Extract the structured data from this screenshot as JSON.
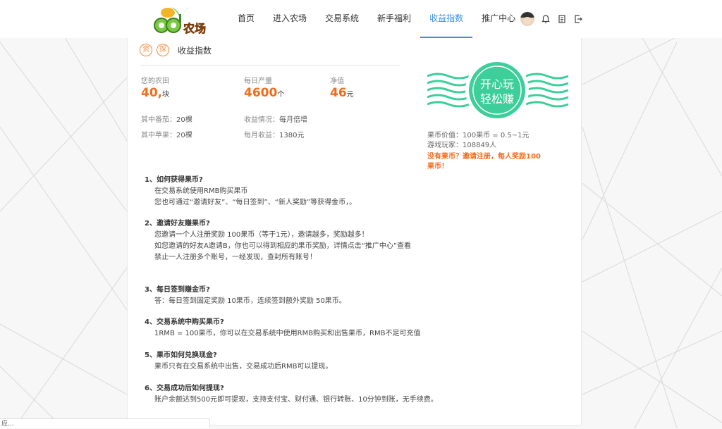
{
  "header": {
    "logo_text": "QQ农场",
    "nav": [
      {
        "label": "首页",
        "active": false
      },
      {
        "label": "进入农场",
        "active": false
      },
      {
        "label": "交易系统",
        "active": false
      },
      {
        "label": "新手福利",
        "active": false
      },
      {
        "label": "收益指数",
        "active": true
      },
      {
        "label": "推广中心",
        "active": false
      }
    ],
    "icons": [
      "avatar",
      "bell-icon",
      "document-icon",
      "exit-icon"
    ]
  },
  "panel": {
    "tags": [
      "资",
      "採"
    ],
    "title": "收益指数",
    "stats": {
      "farmland": {
        "label": "您的农田",
        "value": "40,",
        "unit": "块"
      },
      "daily": {
        "label": "每日产量",
        "value": "4600",
        "unit": "个"
      },
      "net": {
        "label": "净值",
        "value": "46",
        "unit": "元"
      }
    },
    "details": {
      "tomato": {
        "label": "其中番茄：",
        "value": "20棵"
      },
      "apple": {
        "label": "其中苹果：",
        "value": "20棵"
      },
      "income_status": {
        "label": "收益情况：",
        "value": "每月倍增"
      },
      "monthly": {
        "label": "每月收益：",
        "value": "1380元"
      }
    },
    "faq": [
      {
        "q": "1、如何获得果币?",
        "a": [
          "在交易系统使用RMB购买果币",
          "您也可通过“邀请好友”、“每日签到”、“新人奖励”等获得金币，。"
        ]
      },
      {
        "q": "2、邀请好友赚果币?",
        "a": [
          "您邀请一个人注册奖励 100果币（等于1元），邀请越多，奖励越多！",
          "如您邀请的好友A邀请B，你也可以得到相应的果币奖励，详情点击“推广中心”查看",
          "禁止一人注册多个账号，一经发现，查封所有账号！"
        ]
      },
      {
        "q": "3、每日签到赚金币?",
        "a": [
          "答：每日签到固定奖励 10果币，连续签到额外奖励 50果币。"
        ]
      },
      {
        "q": "4、交易系统中购买果币?",
        "a": [
          "1RMB = 100果币，你可以在交易系统中使用RMB购买和出售果币，RMB不足可充值"
        ]
      },
      {
        "q": "5、果币如何兑换现金?",
        "a": [
          "果币只有在交易系统中出售，交易成功后RMB可以提现。"
        ]
      },
      {
        "q": "6、交易成功后如何提现?",
        "a": [
          "账户余额达到500元即可提现，支持支付宝、财付通、银行转账、10分钟到账，无手续费。"
        ]
      }
    ]
  },
  "side": {
    "stamp_line1": "开心玩",
    "stamp_line2": "轻松赚",
    "stamp_color": "#3ccf9a",
    "coin_value": "果币价值：100果币 = 0.5~1元",
    "players": "游戏玩家：108849人",
    "promo": "没有果币？邀请注册，每人奖励100果币！"
  },
  "status_bar": {
    "text": "应..."
  }
}
